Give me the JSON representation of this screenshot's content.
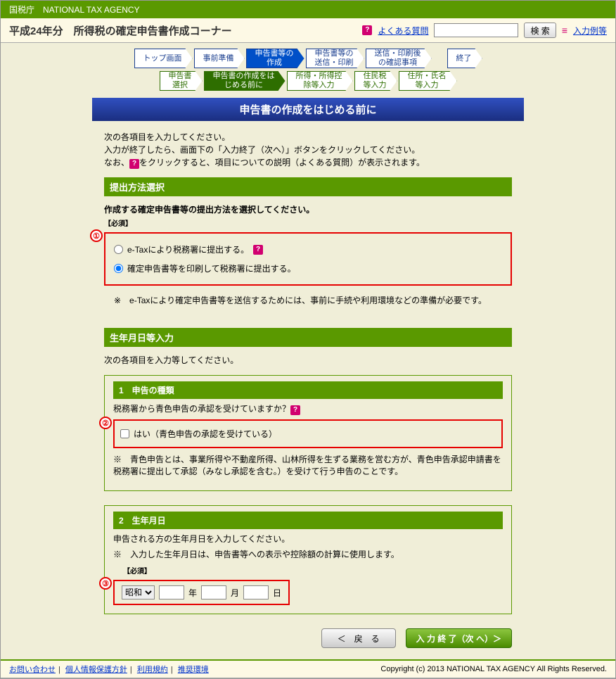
{
  "topBar": "国税庁　NATIONAL TAX AGENCY",
  "header": {
    "title": "平成24年分　所得税の確定申告書作成コーナー",
    "faq": "よくある質問",
    "searchPlaceholder": "",
    "searchBtn": "検 索",
    "examples": "入力例等"
  },
  "bc1": [
    "トップ画面",
    "事前準備",
    "申告書等の\n作成",
    "申告書等の\n送信・印刷",
    "送信・印刷後\nの確認事項",
    "終了"
  ],
  "bc2": [
    "申告書\n選択",
    "申告書の作成をは\nじめる前に",
    "所得・所得控\n除等入力",
    "住民税\n等入力",
    "住所・氏名\n等入力"
  ],
  "pageTitle": "申告書の作成をはじめる前に",
  "intro": {
    "l1": "次の各項目を入力してください。",
    "l2a": "入力が終了したら、画面下の「入力終了（次へ）」ボタンをクリックしてください。",
    "l2b": "なお、",
    "l2c": "をクリックすると、項目についての説明（よくある質問）が表示されます。"
  },
  "sect1": {
    "head": "提出方法選択",
    "prompt": "作成する確定申告書等の提出方法を選択してください。",
    "required": "【必須】",
    "circ": "①",
    "opt1": "e-Taxにより税務署に提出する。",
    "opt2": "確定申告書等を印刷して税務署に提出する。",
    "note": "※　e-Taxにより確定申告書等を送信するためには、事前に手続や利用環境などの準備が必要です。"
  },
  "sect2": {
    "head": "生年月日等入力",
    "lead": "次の各項目を入力等してください。"
  },
  "box1": {
    "title": "1　申告の種類",
    "q": "税務署から青色申告の承認を受けていますか？",
    "circ": "②",
    "chkLabel": "はい（青色申告の承認を受けている）",
    "note": "※　青色申告とは、事業所得や不動産所得、山林所得を生ずる業務を営む方が、青色申告承認申請書を税務署に提出して承認（みなし承認を含む。）を受けて行う申告のことです。"
  },
  "box2": {
    "title": "2　生年月日",
    "l1": "申告される方の生年月日を入力してください。",
    "l2": "※　入力した生年月日は、申告書等への表示や控除額の計算に使用します。",
    "required": "【必須】",
    "circ": "③",
    "era": "昭和",
    "y": "年",
    "m": "月",
    "d": "日"
  },
  "buttons": {
    "prev": "＜　戻　る",
    "next": "入 力 終 了（次 へ）＞"
  },
  "footer": {
    "links": [
      "お問い合わせ",
      "個人情報保護方針",
      "利用規約",
      "推奨環境"
    ],
    "copyright": "Copyright (c) 2013 NATIONAL TAX AGENCY All Rights Reserved."
  }
}
